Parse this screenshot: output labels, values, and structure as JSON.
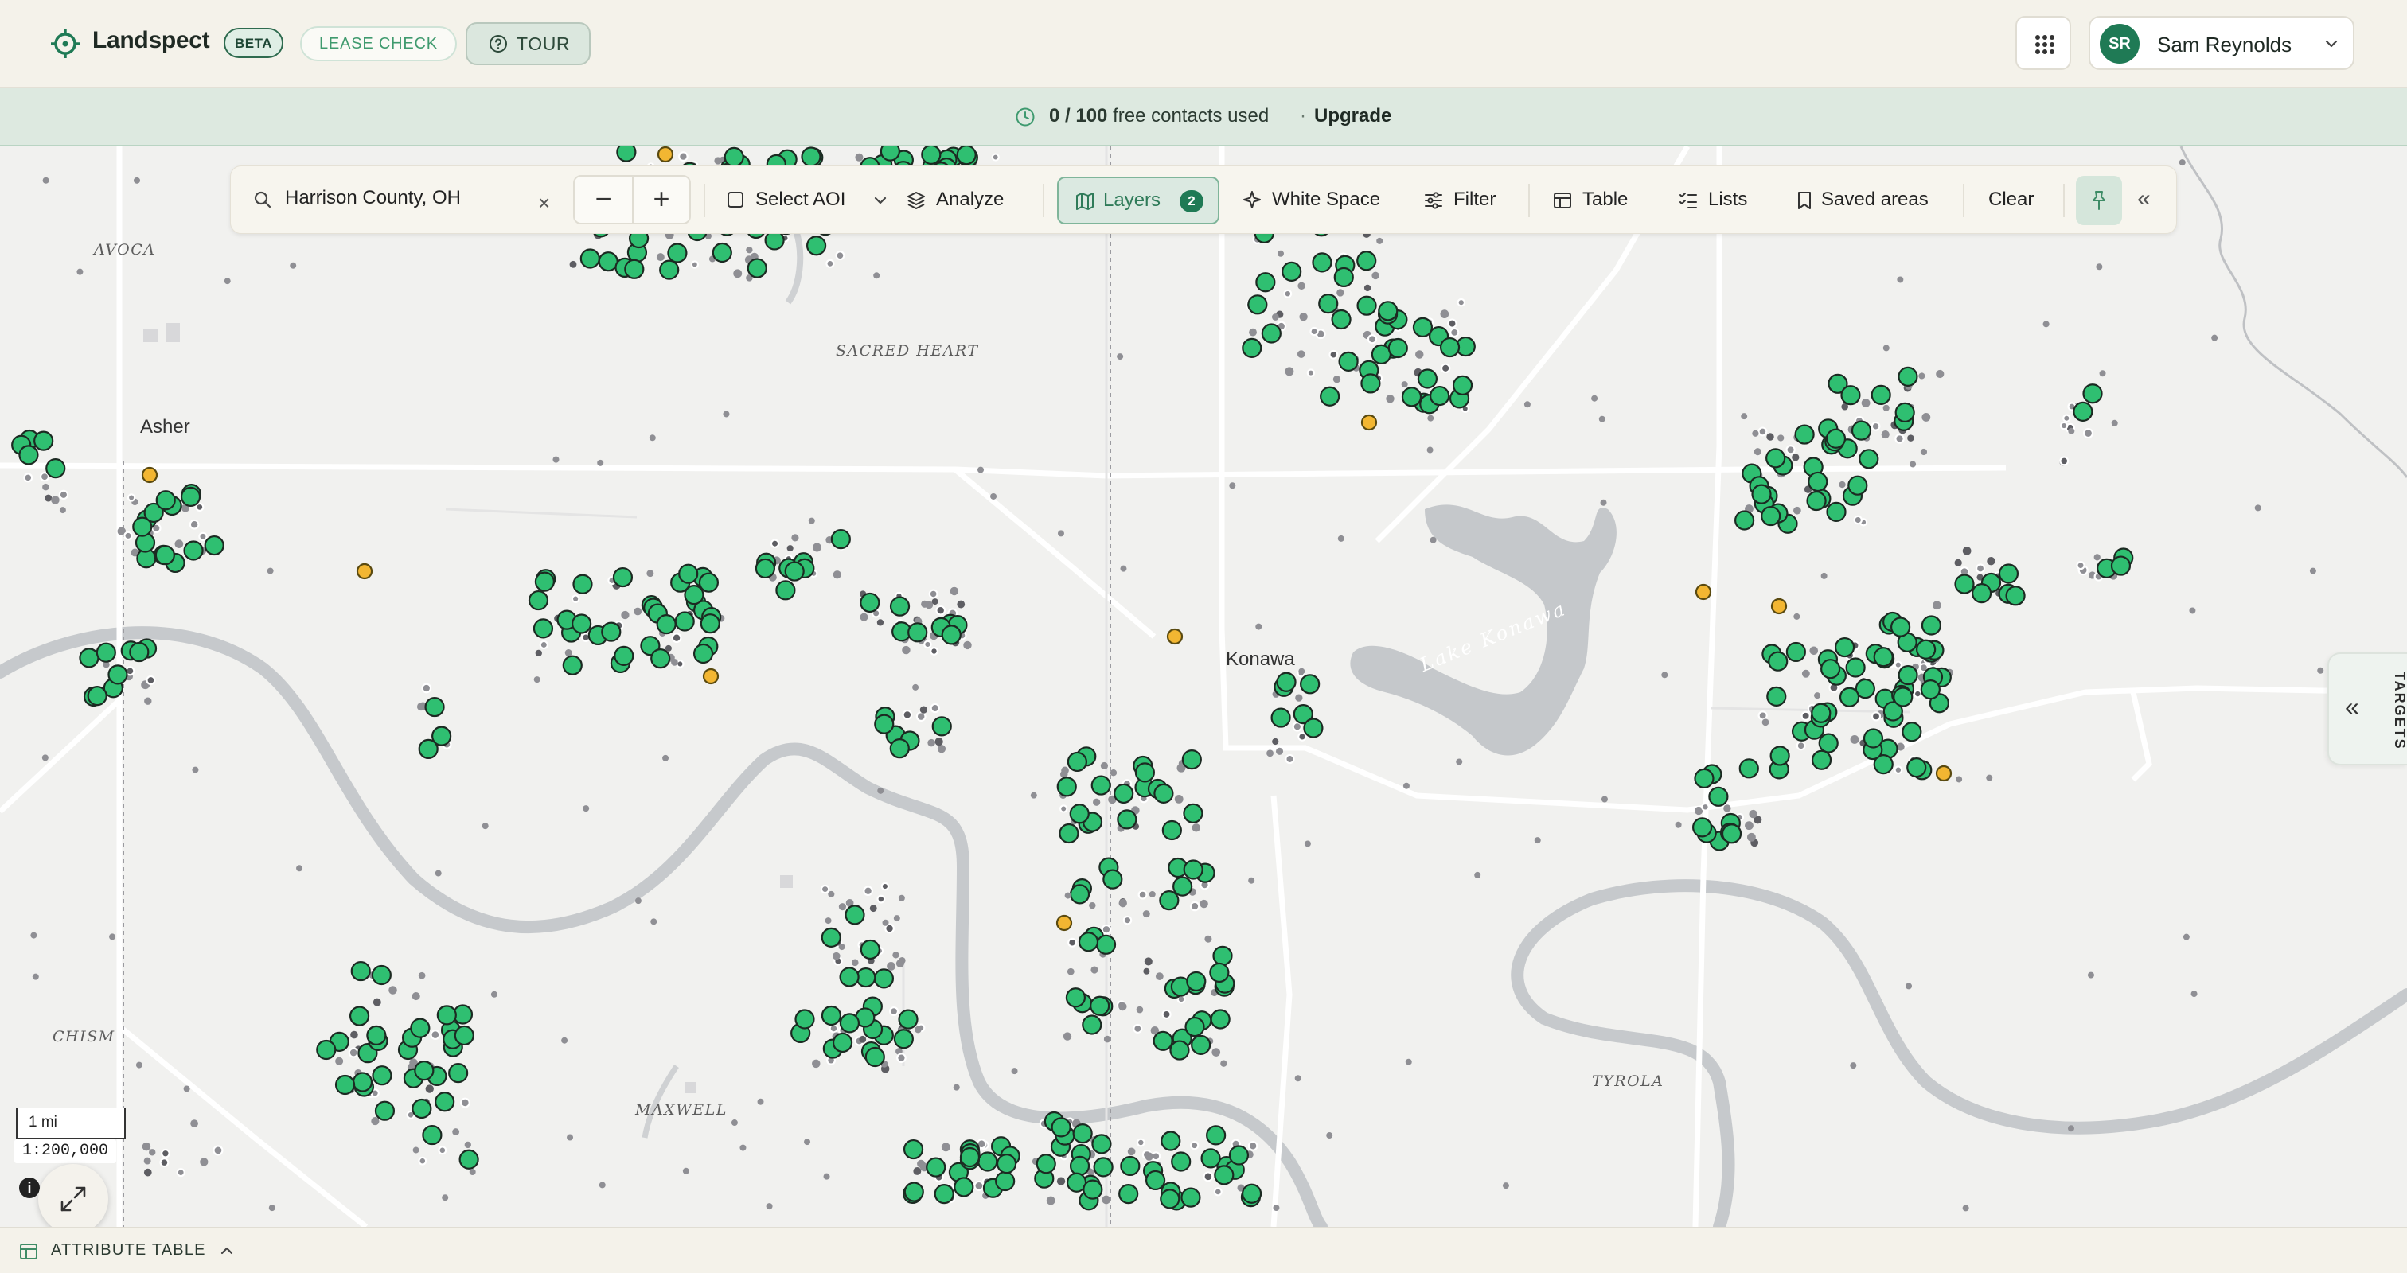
{
  "app": {
    "name": "Landspect",
    "beta_label": "BETA",
    "lease_check_label": "LEASE CHECK",
    "tour_label": "TOUR",
    "icons": [
      "crosshair-logo-icon",
      "help-circle-icon",
      "grid-apps-icon",
      "chevron-down-icon"
    ]
  },
  "user": {
    "initials": "SR",
    "name": "Sam Reynolds"
  },
  "banner": {
    "contacts_used": "0 / 100",
    "contacts_text": "free contacts used",
    "separator": "·",
    "upgrade_label": "Upgrade"
  },
  "toolbar": {
    "search_value": "Harrison County, OH",
    "clear_label": "×",
    "zoom_out": "−",
    "zoom_in": "+",
    "select_aoi": "Select AOI",
    "analyze": "Analyze",
    "layers": "Layers",
    "layers_count": "2",
    "white_space": "White Space",
    "filter": "Filter",
    "table": "Table",
    "lists": "Lists",
    "saved_areas": "Saved areas",
    "clear": "Clear",
    "collapse": "«"
  },
  "map": {
    "places": {
      "avoca": "AVOCA",
      "sacred_heart": "SACRED HEART",
      "chism": "CHISM",
      "maxwell": "MAXWELL",
      "tyrola": "TYROLA"
    },
    "towns": {
      "asher": "Asher",
      "konawa": "Konawa"
    },
    "lake": "Lake Konawa",
    "colors": {
      "well_active": "#2fbf71",
      "well_flag": "#f2b632",
      "well_inactive": "#8f8f94",
      "water": "#c5c8cb",
      "road": "#ffffff"
    }
  },
  "targets_tab": {
    "label": "TARGETS",
    "chevron": "«"
  },
  "scale": {
    "bar_label": "1 mi",
    "ratio": "1:200,000",
    "info": "i"
  },
  "bottom": {
    "attribute_table": "ATTRIBUTE TABLE"
  }
}
